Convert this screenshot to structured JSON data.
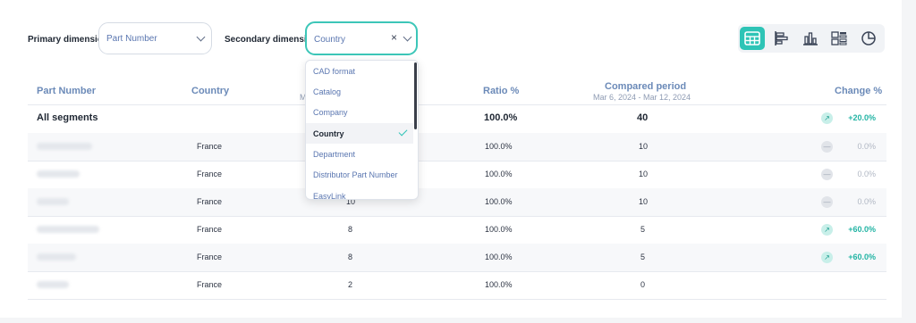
{
  "filters": {
    "primary_label": "Primary dimension",
    "primary_value": "Part Number",
    "secondary_label": "Secondary dimension",
    "secondary_value": "Country",
    "clear_glyph": "×"
  },
  "view_modes": [
    "table-icon",
    "horizontal-bars-icon",
    "vertical-bars-icon",
    "grid-list-icon",
    "pie-chart-icon"
  ],
  "table": {
    "headers": {
      "part_number": "Part Number",
      "country": "Country",
      "period_sub_partial": "M",
      "ratio": "Ratio %",
      "compared": "Compared period",
      "compared_range": "Mar 6, 2024 - Mar 12, 2024",
      "change": "Change %"
    },
    "all_segments": {
      "label": "All segments",
      "ratio": "100.0%",
      "compared": "40",
      "change": "+20.0%"
    },
    "rows": [
      {
        "country": "France",
        "current": "",
        "ratio": "100.0%",
        "compared": "10",
        "change": "0.0%",
        "trend": "flat"
      },
      {
        "country": "France",
        "current": "",
        "ratio": "100.0%",
        "compared": "10",
        "change": "0.0%",
        "trend": "flat"
      },
      {
        "country": "France",
        "current": "10",
        "ratio": "100.0%",
        "compared": "10",
        "change": "0.0%",
        "trend": "flat"
      },
      {
        "country": "France",
        "current": "8",
        "ratio": "100.0%",
        "compared": "5",
        "change": "+60.0%",
        "trend": "up"
      },
      {
        "country": "France",
        "current": "8",
        "ratio": "100.0%",
        "compared": "5",
        "change": "+60.0%",
        "trend": "up"
      },
      {
        "country": "France",
        "current": "2",
        "ratio": "100.0%",
        "compared": "0",
        "change": "",
        "trend": "none"
      }
    ]
  },
  "dropdown": {
    "options": [
      "CAD format",
      "Catalog",
      "Company",
      "Country",
      "Department",
      "Distributor Part Number",
      "EasyLink"
    ],
    "selected": "Country"
  },
  "colors": {
    "accent": "#2ec4b6",
    "header_text": "#6b8ab8",
    "positive": "#23b4a4"
  }
}
